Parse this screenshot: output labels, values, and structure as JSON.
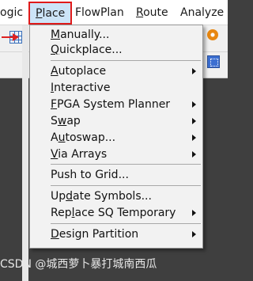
{
  "menubar": {
    "items": [
      {
        "label": "ogic",
        "accel": ""
      },
      {
        "label": "Place",
        "accel": "P"
      },
      {
        "label": "FlowPlan",
        "accel": ""
      },
      {
        "label": "Route",
        "accel": "R"
      },
      {
        "label": "Analyze",
        "accel": ""
      }
    ],
    "highlight_color": "#e01a1a"
  },
  "menu": {
    "sections": [
      [
        "Manually...",
        "Quickplace..."
      ],
      [
        "Autoplace",
        "Interactive",
        "FPGA System Planner",
        "Swap",
        "Autoswap...",
        "Via Arrays"
      ],
      [
        "Push to Grid..."
      ],
      [
        "Update Symbols...",
        "Replace SQ Temporary"
      ],
      [
        "Design Partition"
      ]
    ],
    "items": {
      "manually": {
        "pre": "",
        "u": "M",
        "post": "anually..."
      },
      "quickplace": {
        "pre": "",
        "u": "Q",
        "post": "uickplace..."
      },
      "autoplace": {
        "pre": "",
        "u": "A",
        "post": "utoplace"
      },
      "interactive": {
        "pre": "",
        "u": "I",
        "post": "nteractive"
      },
      "fpga": {
        "pre": "",
        "u": "F",
        "post": "PGA System Planner"
      },
      "swap": {
        "pre": "S",
        "u": "w",
        "post": "ap"
      },
      "autoswap": {
        "pre": "A",
        "u": "u",
        "post": "toswap..."
      },
      "viaarrays": {
        "pre": "",
        "u": "V",
        "post": "ia Arrays"
      },
      "pushgrid": {
        "pre": "Push to Grid...",
        "u": "",
        "post": ""
      },
      "updatesymbols": {
        "pre": "Up",
        "u": "d",
        "post": "ate Symbols..."
      },
      "replacesq": {
        "pre": "Rep",
        "u": "l",
        "post": "ace SQ Temporary"
      },
      "designpartition": {
        "pre": "",
        "u": "D",
        "post": "esign Partition"
      }
    }
  },
  "watermark": "CSDN @城西萝卜暴打城南西瓜",
  "colors": {
    "background": "#3f3f3f",
    "menu_bg": "#f2f2f2",
    "place_highlight": "#cce4f7"
  },
  "icons": [
    "grid-icon",
    "red-arrow-icon",
    "chip-icon",
    "orange-target-icon",
    "blue-select-icon"
  ]
}
